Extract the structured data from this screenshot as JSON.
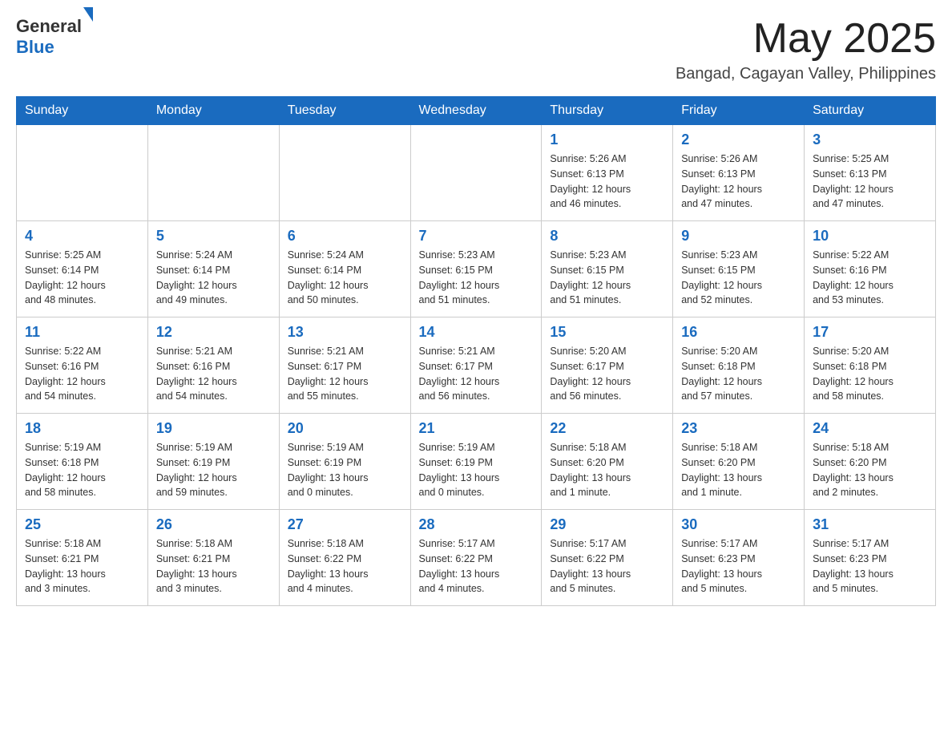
{
  "header": {
    "logo": {
      "text_general": "General",
      "text_blue": "Blue",
      "triangle_color": "#1a6bbf"
    },
    "title": "May 2025",
    "subtitle": "Bangad, Cagayan Valley, Philippines"
  },
  "weekdays": [
    "Sunday",
    "Monday",
    "Tuesday",
    "Wednesday",
    "Thursday",
    "Friday",
    "Saturday"
  ],
  "weeks": [
    {
      "days": [
        {
          "number": "",
          "info": ""
        },
        {
          "number": "",
          "info": ""
        },
        {
          "number": "",
          "info": ""
        },
        {
          "number": "",
          "info": ""
        },
        {
          "number": "1",
          "info": "Sunrise: 5:26 AM\nSunset: 6:13 PM\nDaylight: 12 hours\nand 46 minutes."
        },
        {
          "number": "2",
          "info": "Sunrise: 5:26 AM\nSunset: 6:13 PM\nDaylight: 12 hours\nand 47 minutes."
        },
        {
          "number": "3",
          "info": "Sunrise: 5:25 AM\nSunset: 6:13 PM\nDaylight: 12 hours\nand 47 minutes."
        }
      ]
    },
    {
      "days": [
        {
          "number": "4",
          "info": "Sunrise: 5:25 AM\nSunset: 6:14 PM\nDaylight: 12 hours\nand 48 minutes."
        },
        {
          "number": "5",
          "info": "Sunrise: 5:24 AM\nSunset: 6:14 PM\nDaylight: 12 hours\nand 49 minutes."
        },
        {
          "number": "6",
          "info": "Sunrise: 5:24 AM\nSunset: 6:14 PM\nDaylight: 12 hours\nand 50 minutes."
        },
        {
          "number": "7",
          "info": "Sunrise: 5:23 AM\nSunset: 6:15 PM\nDaylight: 12 hours\nand 51 minutes."
        },
        {
          "number": "8",
          "info": "Sunrise: 5:23 AM\nSunset: 6:15 PM\nDaylight: 12 hours\nand 51 minutes."
        },
        {
          "number": "9",
          "info": "Sunrise: 5:23 AM\nSunset: 6:15 PM\nDaylight: 12 hours\nand 52 minutes."
        },
        {
          "number": "10",
          "info": "Sunrise: 5:22 AM\nSunset: 6:16 PM\nDaylight: 12 hours\nand 53 minutes."
        }
      ]
    },
    {
      "days": [
        {
          "number": "11",
          "info": "Sunrise: 5:22 AM\nSunset: 6:16 PM\nDaylight: 12 hours\nand 54 minutes."
        },
        {
          "number": "12",
          "info": "Sunrise: 5:21 AM\nSunset: 6:16 PM\nDaylight: 12 hours\nand 54 minutes."
        },
        {
          "number": "13",
          "info": "Sunrise: 5:21 AM\nSunset: 6:17 PM\nDaylight: 12 hours\nand 55 minutes."
        },
        {
          "number": "14",
          "info": "Sunrise: 5:21 AM\nSunset: 6:17 PM\nDaylight: 12 hours\nand 56 minutes."
        },
        {
          "number": "15",
          "info": "Sunrise: 5:20 AM\nSunset: 6:17 PM\nDaylight: 12 hours\nand 56 minutes."
        },
        {
          "number": "16",
          "info": "Sunrise: 5:20 AM\nSunset: 6:18 PM\nDaylight: 12 hours\nand 57 minutes."
        },
        {
          "number": "17",
          "info": "Sunrise: 5:20 AM\nSunset: 6:18 PM\nDaylight: 12 hours\nand 58 minutes."
        }
      ]
    },
    {
      "days": [
        {
          "number": "18",
          "info": "Sunrise: 5:19 AM\nSunset: 6:18 PM\nDaylight: 12 hours\nand 58 minutes."
        },
        {
          "number": "19",
          "info": "Sunrise: 5:19 AM\nSunset: 6:19 PM\nDaylight: 12 hours\nand 59 minutes."
        },
        {
          "number": "20",
          "info": "Sunrise: 5:19 AM\nSunset: 6:19 PM\nDaylight: 13 hours\nand 0 minutes."
        },
        {
          "number": "21",
          "info": "Sunrise: 5:19 AM\nSunset: 6:19 PM\nDaylight: 13 hours\nand 0 minutes."
        },
        {
          "number": "22",
          "info": "Sunrise: 5:18 AM\nSunset: 6:20 PM\nDaylight: 13 hours\nand 1 minute."
        },
        {
          "number": "23",
          "info": "Sunrise: 5:18 AM\nSunset: 6:20 PM\nDaylight: 13 hours\nand 1 minute."
        },
        {
          "number": "24",
          "info": "Sunrise: 5:18 AM\nSunset: 6:20 PM\nDaylight: 13 hours\nand 2 minutes."
        }
      ]
    },
    {
      "days": [
        {
          "number": "25",
          "info": "Sunrise: 5:18 AM\nSunset: 6:21 PM\nDaylight: 13 hours\nand 3 minutes."
        },
        {
          "number": "26",
          "info": "Sunrise: 5:18 AM\nSunset: 6:21 PM\nDaylight: 13 hours\nand 3 minutes."
        },
        {
          "number": "27",
          "info": "Sunrise: 5:18 AM\nSunset: 6:22 PM\nDaylight: 13 hours\nand 4 minutes."
        },
        {
          "number": "28",
          "info": "Sunrise: 5:17 AM\nSunset: 6:22 PM\nDaylight: 13 hours\nand 4 minutes."
        },
        {
          "number": "29",
          "info": "Sunrise: 5:17 AM\nSunset: 6:22 PM\nDaylight: 13 hours\nand 5 minutes."
        },
        {
          "number": "30",
          "info": "Sunrise: 5:17 AM\nSunset: 6:23 PM\nDaylight: 13 hours\nand 5 minutes."
        },
        {
          "number": "31",
          "info": "Sunrise: 5:17 AM\nSunset: 6:23 PM\nDaylight: 13 hours\nand 5 minutes."
        }
      ]
    }
  ]
}
